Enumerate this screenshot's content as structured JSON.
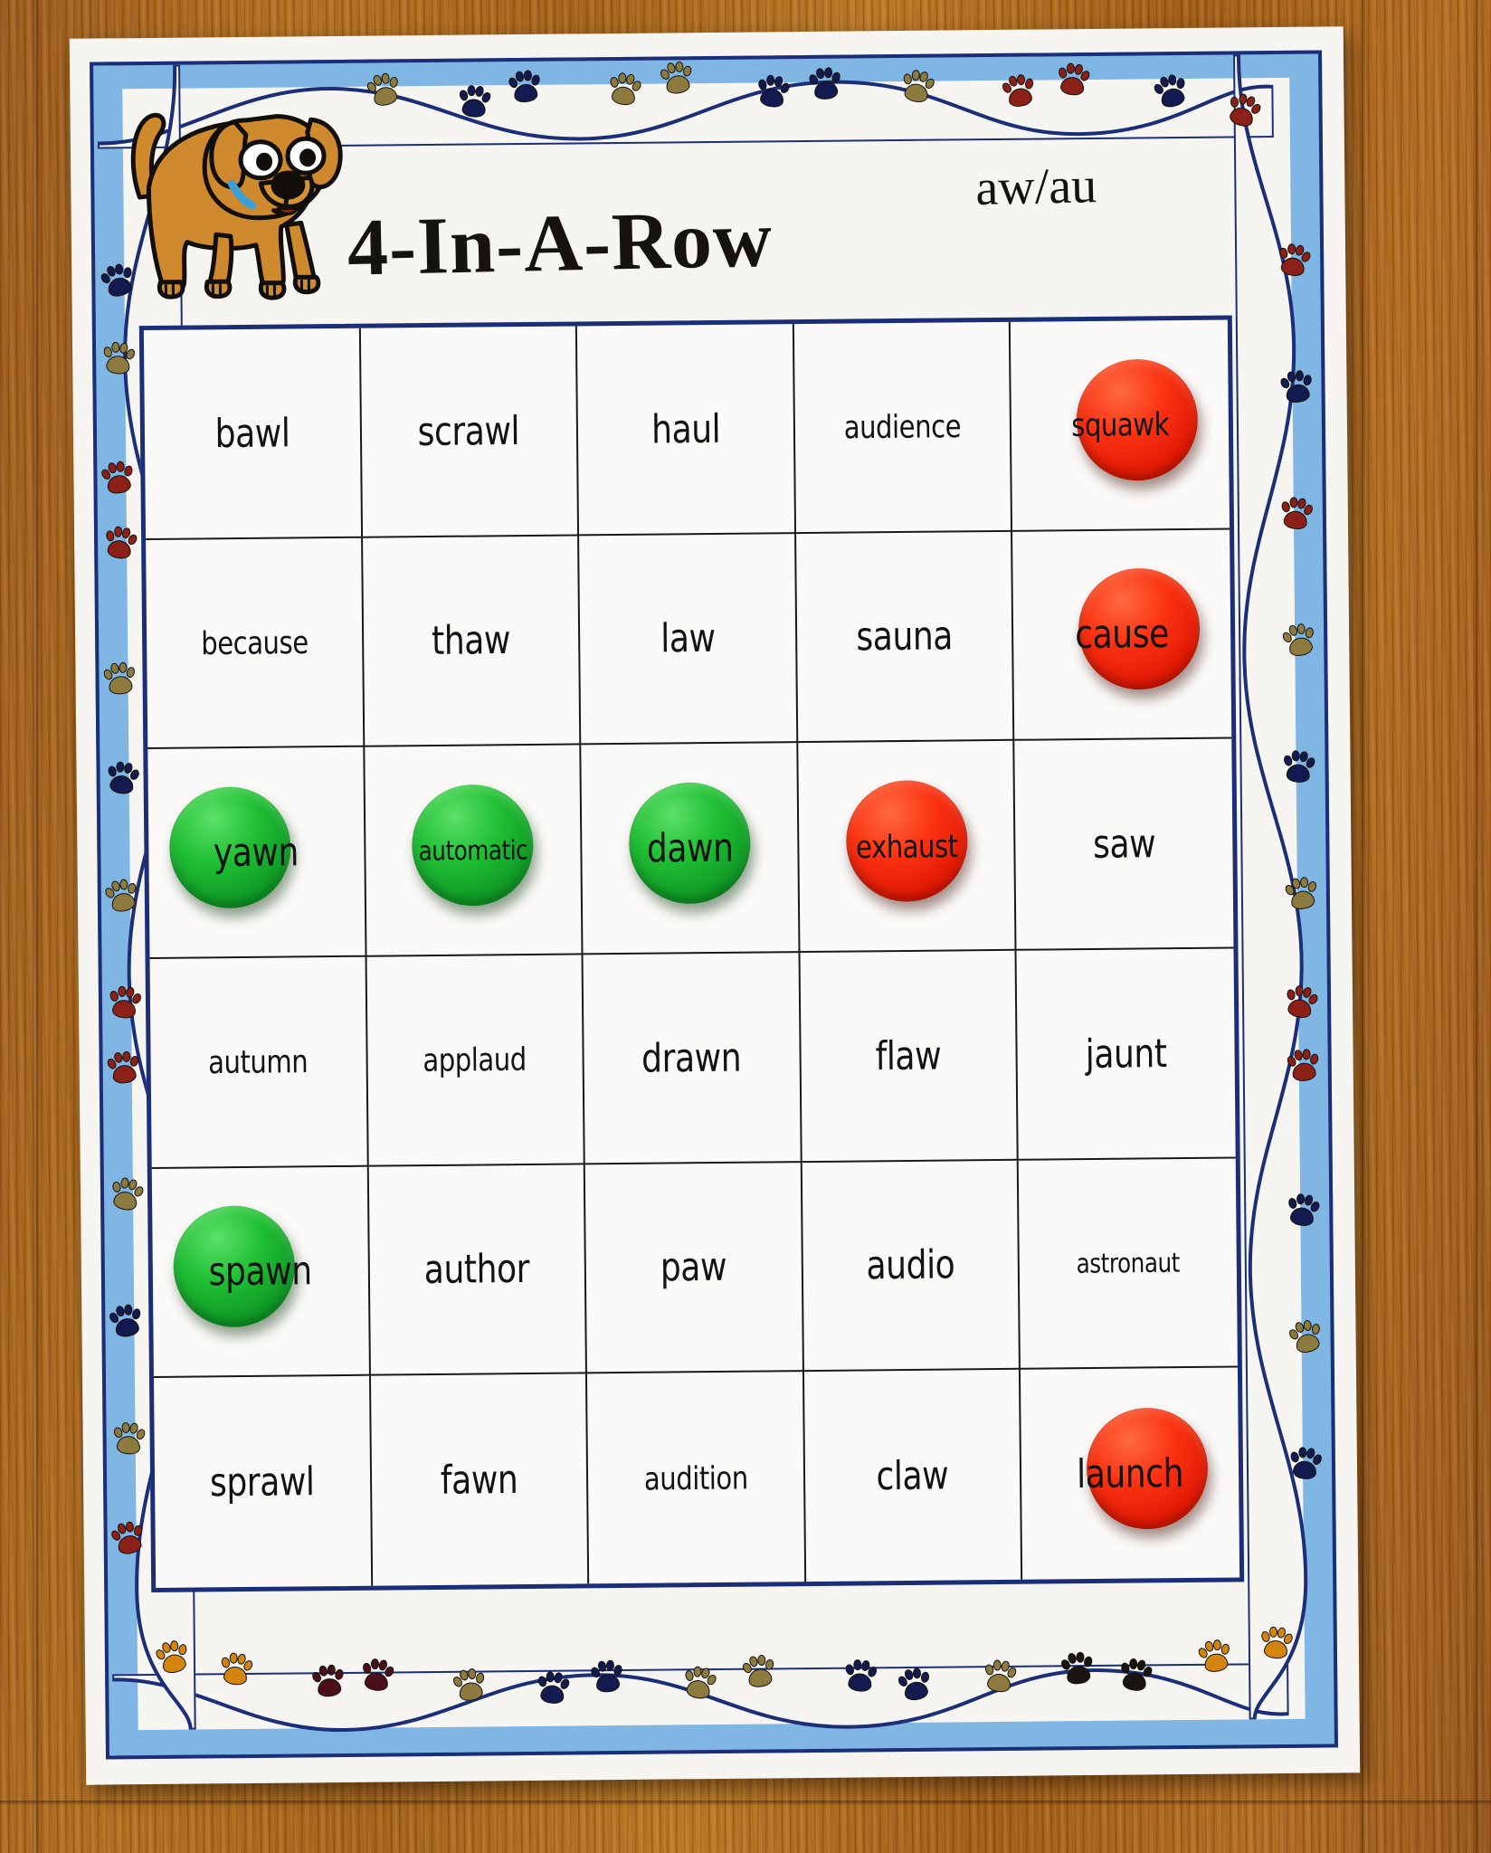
{
  "board": {
    "title": "4-In-A-Row",
    "phonics_label": "aw/au",
    "mascot_icon": "dog-icon",
    "theme_colors": {
      "border_navy": "#1b2e77",
      "border_blue": "#7fb6e4",
      "paper": "#f6f5f2",
      "wood": "#a9621f",
      "chip_red": "#e8200a",
      "chip_green": "#15b52a"
    },
    "grid": {
      "rows": 6,
      "columns": 5,
      "cells": [
        {
          "word": "bawl",
          "chip": null,
          "size": "normal"
        },
        {
          "word": "scrawl",
          "chip": null,
          "size": "normal"
        },
        {
          "word": "haul",
          "chip": null,
          "size": "normal"
        },
        {
          "word": "audience",
          "chip": null,
          "size": "long"
        },
        {
          "word": "squawk",
          "chip": "red",
          "size": "long"
        },
        {
          "word": "because",
          "chip": null,
          "size": "long"
        },
        {
          "word": "thaw",
          "chip": null,
          "size": "normal"
        },
        {
          "word": "law",
          "chip": null,
          "size": "normal"
        },
        {
          "word": "sauna",
          "chip": null,
          "size": "normal"
        },
        {
          "word": "cause",
          "chip": "red",
          "size": "normal"
        },
        {
          "word": "yawn",
          "chip": "green",
          "size": "normal"
        },
        {
          "word": "automatic",
          "chip": "green",
          "size": "xlong"
        },
        {
          "word": "dawn",
          "chip": "green",
          "size": "normal"
        },
        {
          "word": "exhaust",
          "chip": "red",
          "size": "long"
        },
        {
          "word": "saw",
          "chip": null,
          "size": "normal"
        },
        {
          "word": "autumn",
          "chip": null,
          "size": "long"
        },
        {
          "word": "applaud",
          "chip": null,
          "size": "long"
        },
        {
          "word": "drawn",
          "chip": null,
          "size": "normal"
        },
        {
          "word": "flaw",
          "chip": null,
          "size": "normal"
        },
        {
          "word": "jaunt",
          "chip": null,
          "size": "normal"
        },
        {
          "word": "spawn",
          "chip": "green",
          "size": "normal"
        },
        {
          "word": "author",
          "chip": null,
          "size": "normal"
        },
        {
          "word": "paw",
          "chip": null,
          "size": "normal"
        },
        {
          "word": "audio",
          "chip": null,
          "size": "normal"
        },
        {
          "word": "astronaut",
          "chip": null,
          "size": "xlong"
        },
        {
          "word": "sprawl",
          "chip": null,
          "size": "normal"
        },
        {
          "word": "fawn",
          "chip": null,
          "size": "normal"
        },
        {
          "word": "audition",
          "chip": null,
          "size": "long"
        },
        {
          "word": "claw",
          "chip": null,
          "size": "normal"
        },
        {
          "word": "launch",
          "chip": "red",
          "size": "normal"
        }
      ]
    }
  }
}
